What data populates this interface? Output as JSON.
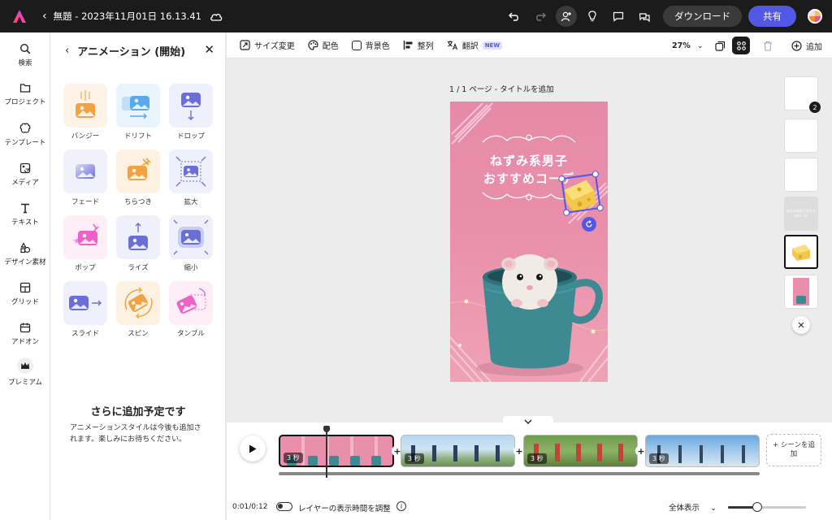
{
  "topbar": {
    "doc_title": "無題 - 2023年11月01日 16.13.41",
    "download_label": "ダウンロード",
    "share_label": "共有"
  },
  "leftnav": {
    "items": [
      {
        "label": "検索",
        "icon": "search-icon"
      },
      {
        "label": "プロジェクト",
        "icon": "folder-icon"
      },
      {
        "label": "テンプレート",
        "icon": "template-icon"
      },
      {
        "label": "メディア",
        "icon": "media-icon"
      },
      {
        "label": "テキスト",
        "icon": "text-icon"
      },
      {
        "label": "デザイン素材",
        "icon": "design-assets-icon"
      },
      {
        "label": "グリッド",
        "icon": "grid-icon"
      },
      {
        "label": "アドオン",
        "icon": "addon-icon"
      },
      {
        "label": "プレミアム",
        "icon": "premium-crown-icon"
      }
    ]
  },
  "panel": {
    "title": "アニメーション (開始)",
    "animations": [
      {
        "label": "バンジー",
        "icon": "bungee-icon"
      },
      {
        "label": "ドリフト",
        "icon": "drift-icon"
      },
      {
        "label": "ドロップ",
        "icon": "drop-icon"
      },
      {
        "label": "フェード",
        "icon": "fade-icon"
      },
      {
        "label": "ちらつき",
        "icon": "flicker-icon"
      },
      {
        "label": "拡大",
        "icon": "zoom-in-icon"
      },
      {
        "label": "ポップ",
        "icon": "pop-icon"
      },
      {
        "label": "ライズ",
        "icon": "rise-icon"
      },
      {
        "label": "縮小",
        "icon": "zoom-out-icon"
      },
      {
        "label": "スライド",
        "icon": "slide-icon"
      },
      {
        "label": "スピン",
        "icon": "spin-icon"
      },
      {
        "label": "タンブル",
        "icon": "tumble-icon"
      }
    ],
    "more_title": "さらに追加予定です",
    "more_desc": "アニメーションスタイルは今後も追加されます。楽しみにお待ちください。"
  },
  "toolbar": {
    "resize": "サイズ変更",
    "color_scheme": "配色",
    "background_color": "背景色",
    "align": "整列",
    "translate": "翻訳",
    "new_badge": "NEW",
    "zoom": "27%",
    "add": "追加"
  },
  "canvas": {
    "page_label": "1 / 1 ページ - タイトルを追加",
    "heading_line1": "ねずみ系男子",
    "heading_line2": "おすすめコーデ"
  },
  "thumbnails": {
    "stack_count": "2",
    "mini_text": "ねずみ系男子おすすめコーデ"
  },
  "timeline": {
    "clips": [
      {
        "duration": "3 秒",
        "scene": "hamster",
        "active": true
      },
      {
        "duration": "3 秒",
        "scene": "hikers-blue"
      },
      {
        "duration": "3 秒",
        "scene": "hikers-green"
      },
      {
        "duration": "3 秒",
        "scene": "hikers-sky"
      }
    ],
    "add_scene": "+ シーンを追加",
    "time": "0:01/0:12",
    "toggle_label": "レイヤーの表示時間を調整",
    "view_all": "全体表示",
    "zoom_slider": 0.37
  },
  "colors": {
    "accent": "#5258e4",
    "topbar_bg": "#1b1b1b",
    "canvas_pink": "#e98fab"
  }
}
